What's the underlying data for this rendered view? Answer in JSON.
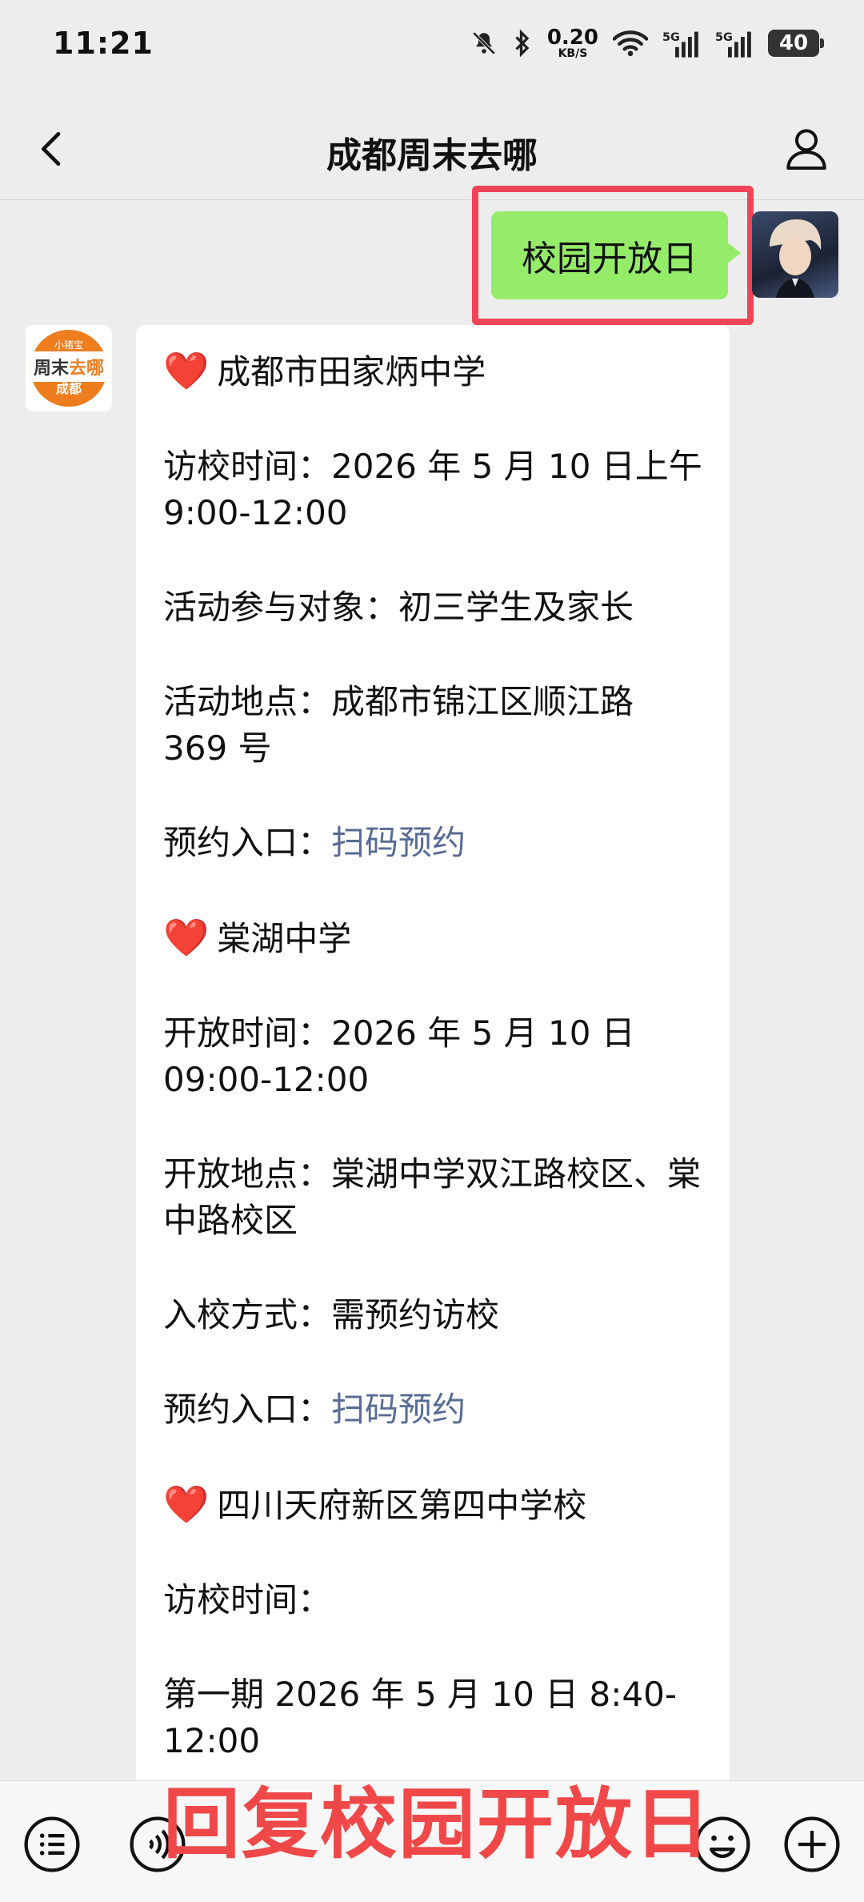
{
  "status": {
    "time": "11:21",
    "speed_value": "0.20",
    "speed_unit": "KB/S",
    "battery": "40",
    "network_1": "5G",
    "network_2": "5G"
  },
  "nav": {
    "title": "成都周末去哪"
  },
  "my_message": "校园开放日",
  "account_avatar": {
    "top": "小猪宝",
    "middle_a": "周末",
    "middle_b": "去哪",
    "bottom": "成都"
  },
  "reply": {
    "heart": "❤️",
    "school1": {
      "name": "成都市田家炳中学",
      "time": "访校时间：2026 年 5 月 10 日上午 9:00-12:00",
      "audience": "活动参与对象：初三学生及家长",
      "location": "活动地点：成都市锦江区顺江路 369 号",
      "booking_label": "预约入口：",
      "booking_link": "扫码预约"
    },
    "school2": {
      "name": "棠湖中学",
      "time": "开放时间：2026 年 5 月 10 日 09:00-12:00",
      "location": "开放地点：棠湖中学双江路校区、棠中路校区",
      "entry": "入校方式：需预约访校",
      "booking_label": "预约入口：",
      "booking_link": "扫码预约"
    },
    "school3": {
      "name": "四川天府新区第四中学校",
      "time_label": "访校时间：",
      "phase1": "第一期 2026 年 5 月 10 日 8:40-12:00"
    }
  },
  "overlay_text": "回复校园开放日"
}
